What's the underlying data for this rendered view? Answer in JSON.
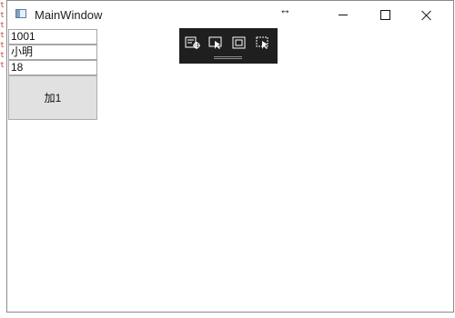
{
  "background_code": {
    "lines": [
      "t",
      "t",
      "t",
      "t",
      "t",
      "t",
      "t"
    ]
  },
  "window": {
    "title": "MainWindow",
    "icon": "app-window-icon",
    "caption_buttons": [
      {
        "name": "minimize-button",
        "icon": "minimize-icon"
      },
      {
        "name": "maximize-button",
        "icon": "maximize-icon"
      },
      {
        "name": "close-button",
        "icon": "close-icon"
      }
    ],
    "resize_cursor": "↔"
  },
  "form": {
    "id_value": "1001",
    "name_value": "小明",
    "age_value": "18",
    "button_label": "加1"
  },
  "debug_toolbar": {
    "tools": [
      {
        "name": "live-visual-tree-icon"
      },
      {
        "name": "select-element-icon"
      },
      {
        "name": "display-layout-adorners-icon"
      },
      {
        "name": "track-focused-element-icon"
      }
    ]
  },
  "colors": {
    "window_background": "#ffffff",
    "toolbar_background": "#1f1f1f",
    "button_background": "#e1e1e1",
    "button_border": "#adadad",
    "field_border": "#a6a6a6",
    "code_text": "#c0392b"
  }
}
